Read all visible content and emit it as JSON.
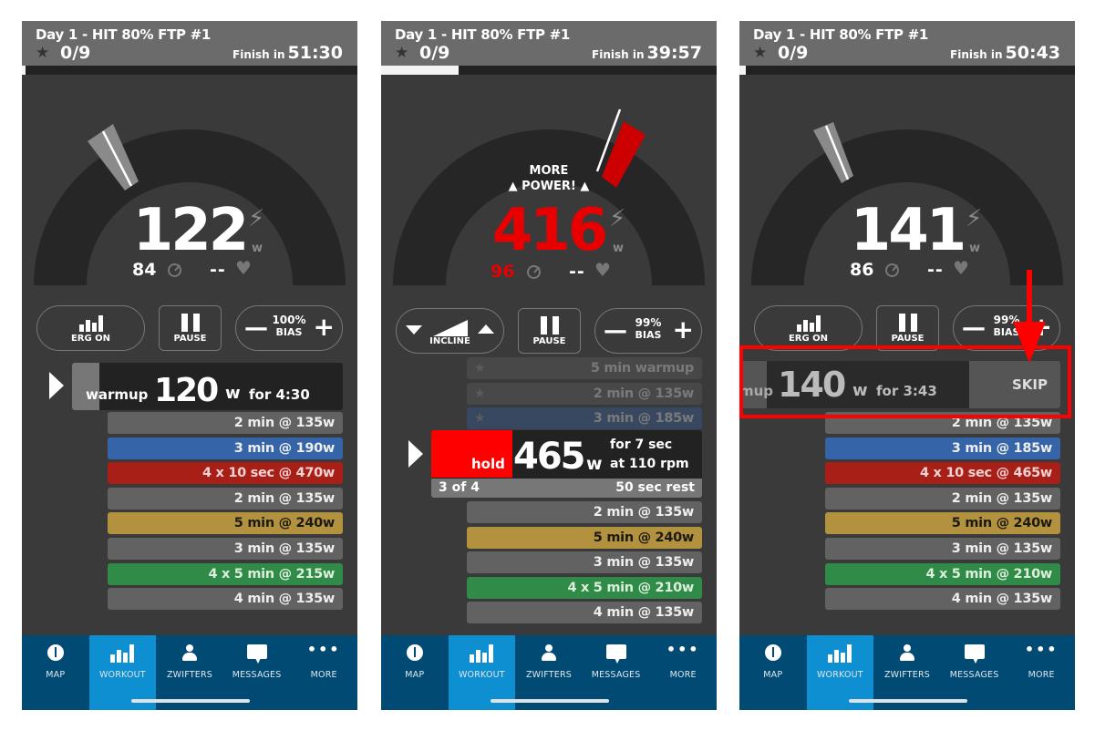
{
  "panels": [
    {
      "header": {
        "title": "Day 1 - HIT 80% FTP #1",
        "stars": "0/9",
        "finish_label": "Finish in",
        "finish_time": "51:30"
      },
      "progress": 0.0,
      "gauge": {
        "power": "122",
        "power_unit": "w",
        "cadence": "84",
        "heart_rate": "--",
        "alert": null
      },
      "controls": {
        "mode_label": "ERG ON",
        "pause_label": "PAUSE",
        "bias_value": "100%",
        "bias_label": "BIAS"
      },
      "current": {
        "name": "warmup",
        "watts": "120",
        "unit": "w",
        "duration": "for 4:30"
      },
      "intervals": [
        {
          "label": "2 min @ 135w",
          "zone": "gray"
        },
        {
          "label": "3 min @ 190w",
          "zone": "blue"
        },
        {
          "label": "4 x 10 sec @ 470w",
          "zone": "red"
        },
        {
          "label": "2 min @ 135w",
          "zone": "gray"
        },
        {
          "label": "5 min @ 240w",
          "zone": "yellow"
        },
        {
          "label": "3 min @ 135w",
          "zone": "gray"
        },
        {
          "label": "4 x 5 min @ 215w",
          "zone": "green"
        },
        {
          "label": "4 min @ 135w",
          "zone": "gray"
        }
      ]
    },
    {
      "header": {
        "title": "Day 1 - HIT 80% FTP #1",
        "stars": "0/9",
        "finish_label": "Finish in",
        "finish_time": "39:57"
      },
      "progress": 0.23,
      "gauge": {
        "power": "416",
        "power_unit": "w",
        "cadence": "96",
        "heart_rate": "--",
        "alert_line1": "MORE",
        "alert_line2": "POWER!"
      },
      "controls": {
        "mode_label": "INCLINE",
        "pause_label": "PAUSE",
        "bias_value": "99%",
        "bias_label": "BIAS"
      },
      "completed": [
        {
          "label": "5 min warmup",
          "zone": "gray"
        },
        {
          "label": "2 min @ 135w",
          "zone": "gray"
        },
        {
          "label": "3 min @ 185w",
          "zone": "blue"
        }
      ],
      "current": {
        "name": "hold",
        "watts": "465",
        "unit": "w",
        "duration_line1": "for 7 sec",
        "duration_line2": "at 110 rpm",
        "rep": "3 of 4",
        "rest": "50 sec rest"
      },
      "intervals": [
        {
          "label": "2 min @ 135w",
          "zone": "gray"
        },
        {
          "label": "5 min @ 240w",
          "zone": "yellow"
        },
        {
          "label": "3 min @ 135w",
          "zone": "gray"
        },
        {
          "label": "4 x 5 min @ 210w",
          "zone": "green"
        },
        {
          "label": "4 min @ 135w",
          "zone": "gray"
        }
      ]
    },
    {
      "header": {
        "title": "Day 1 - HIT 80% FTP #1",
        "stars": "0/9",
        "finish_label": "Finish in",
        "finish_time": "50:43"
      },
      "progress": 0.02,
      "gauge": {
        "power": "141",
        "power_unit": "w",
        "cadence": "86",
        "heart_rate": "--",
        "alert": null
      },
      "controls": {
        "mode_label": "ERG ON",
        "pause_label": "PAUSE",
        "bias_value": "99%",
        "bias_label": "BIAS"
      },
      "current": {
        "name": "mup",
        "watts": "140",
        "unit": "w",
        "duration": "for 3:43",
        "skip_label": "SKIP"
      },
      "intervals": [
        {
          "label": "2 min @ 135w",
          "zone": "gray"
        },
        {
          "label": "3 min @ 185w",
          "zone": "blue"
        },
        {
          "label": "4 x 10 sec @ 465w",
          "zone": "red"
        },
        {
          "label": "2 min @ 135w",
          "zone": "gray"
        },
        {
          "label": "5 min @ 240w",
          "zone": "yellow"
        },
        {
          "label": "3 min @ 135w",
          "zone": "gray"
        },
        {
          "label": "4 x 5 min @ 210w",
          "zone": "green"
        },
        {
          "label": "4 min @ 135w",
          "zone": "gray"
        }
      ]
    }
  ],
  "nav": [
    {
      "label": "MAP",
      "icon": "compass-icon"
    },
    {
      "label": "WORKOUT",
      "icon": "workout-bars-icon",
      "active": true
    },
    {
      "label": "ZWIFTERS",
      "icon": "person-icon"
    },
    {
      "label": "MESSAGES",
      "icon": "message-bubble-icon"
    },
    {
      "label": "MORE",
      "icon": "more-dots-icon"
    }
  ],
  "colors": {
    "header": "#6b6b6b",
    "background": "#3a3a3a",
    "nav": "#004a73",
    "nav_active": "#0d8fd2",
    "alert_red": "#ff0000",
    "zone_blue": "#3564a8",
    "zone_red": "#a81f18",
    "zone_yellow": "#b3923f",
    "zone_green": "#2f8b47",
    "zone_gray": "#626262"
  }
}
